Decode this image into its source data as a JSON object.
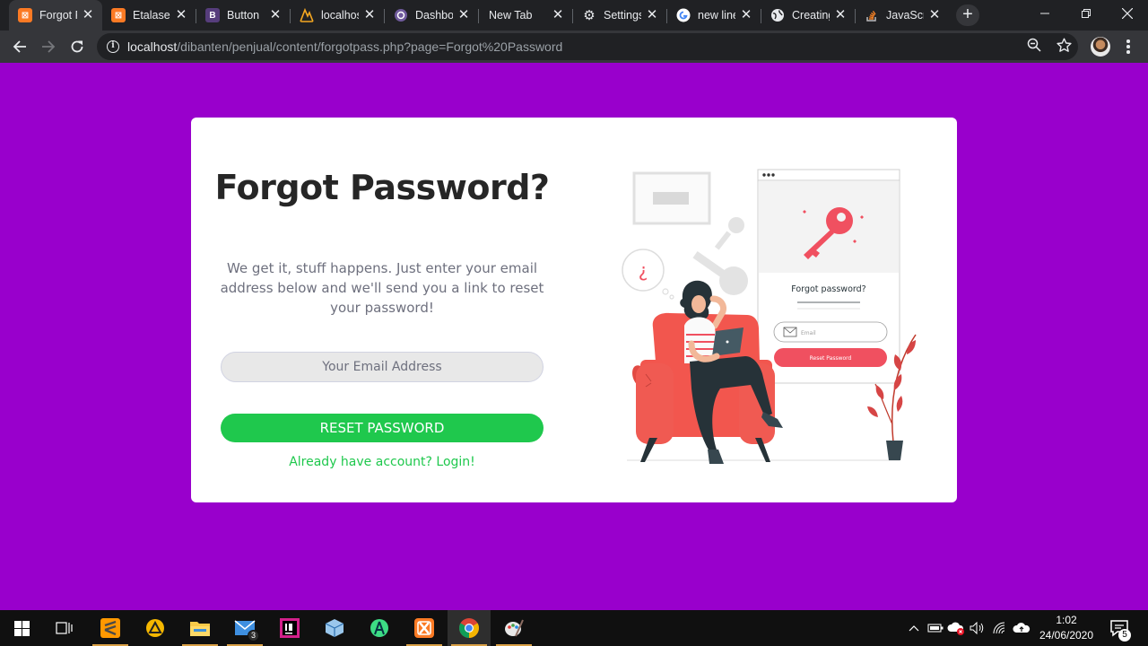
{
  "browser": {
    "tabs": [
      {
        "title": "Forgot P",
        "icon": "xampp-icon",
        "active": true
      },
      {
        "title": "Etalase",
        "icon": "xampp-icon"
      },
      {
        "title": "Button",
        "icon": "bootstrap-icon"
      },
      {
        "title": "localhost",
        "icon": "phpmyadmin-icon"
      },
      {
        "title": "Dashboard",
        "icon": "php-icon"
      },
      {
        "title": "New Tab",
        "icon": ""
      },
      {
        "title": "Settings",
        "icon": "gear-icon"
      },
      {
        "title": "new line",
        "icon": "google-icon"
      },
      {
        "title": "Creating",
        "icon": "globe-icon"
      },
      {
        "title": "JavaScript",
        "icon": "stackoverflow-icon"
      }
    ],
    "address": {
      "host": "localhost",
      "path": "/dibanten/penjual/content/forgotpass.php?page=Forgot%20Password"
    }
  },
  "page": {
    "title": "Forgot Password?",
    "subtitle": "We get it, stuff happens. Just enter your email address below and we'll send you a link to reset your password!",
    "email_placeholder": "Your Email Address",
    "reset_button": "RESET PASSWORD",
    "login_link": "Already have account? Login!",
    "illustration": {
      "panel_title": "Forgot password?",
      "email_placeholder": "Email",
      "button_label": "Reset Password",
      "question_mark": "¿"
    },
    "colors": {
      "background": "#9900cc",
      "accent_green": "#1fc84d",
      "illustration_red": "#f05060"
    }
  },
  "taskbar": {
    "apps": [
      "windows-start-icon",
      "task-view-icon",
      "sublime-text-icon",
      "app-triangle-icon",
      "file-explorer-icon",
      "mail-icon",
      "jetbrains-icon",
      "virtualbox-icon",
      "android-studio-icon",
      "xampp-icon",
      "chrome-icon",
      "paint-icon"
    ],
    "mail_badge": "3",
    "time": "1:02",
    "date": "24/06/2020",
    "notifications": "5"
  }
}
